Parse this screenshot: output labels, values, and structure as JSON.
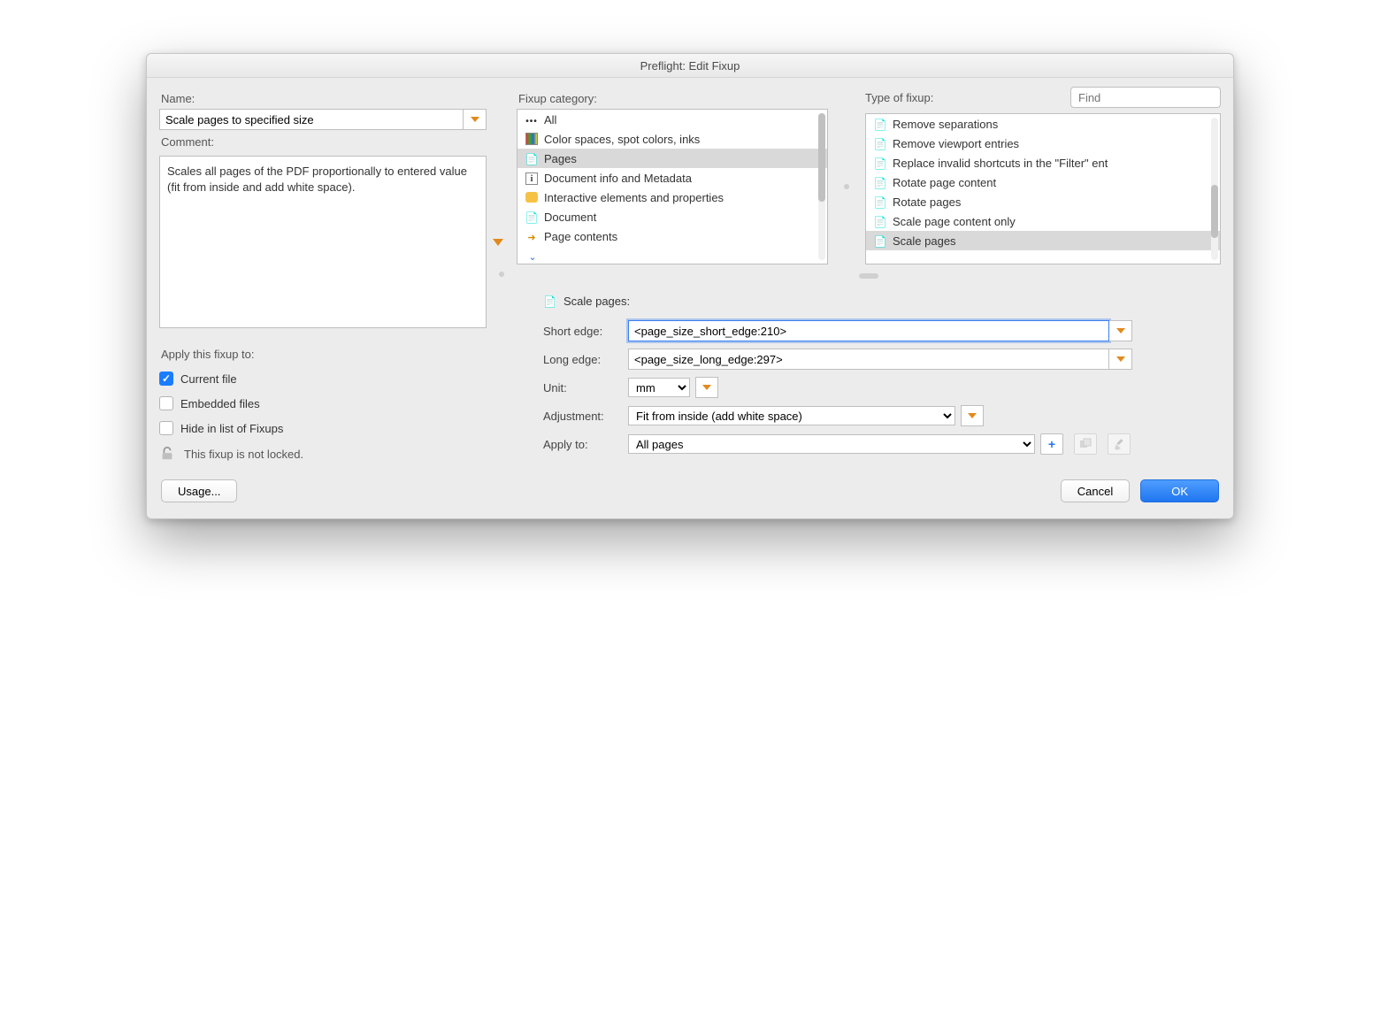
{
  "window": {
    "title": "Preflight: Edit Fixup"
  },
  "left": {
    "name_label": "Name:",
    "name_value": "Scale pages to specified size",
    "comment_label": "Comment:",
    "comment_text": "Scales all pages of the PDF proportionally to entered value (fit from inside and add white space).",
    "apply_label": "Apply this fixup to:",
    "chk_current": "Current file",
    "chk_embedded": "Embedded files",
    "chk_hide": "Hide in list of Fixups",
    "lock_text": "This fixup is not locked.",
    "usage_btn": "Usage..."
  },
  "categories": {
    "label": "Fixup category:",
    "items": [
      {
        "icon": "dots",
        "label": "All"
      },
      {
        "icon": "swatch",
        "label": "Color spaces, spot colors, inks"
      },
      {
        "icon": "pdf",
        "label": "Pages",
        "selected": true
      },
      {
        "icon": "info",
        "label": "Document info and Metadata"
      },
      {
        "icon": "bubble",
        "label": "Interactive elements and properties"
      },
      {
        "icon": "pdf",
        "label": "Document"
      },
      {
        "icon": "arrow",
        "label": "Page contents"
      }
    ]
  },
  "types": {
    "label": "Type of fixup:",
    "find_placeholder": "Find",
    "items": [
      {
        "label": "Remove separations"
      },
      {
        "label": "Remove viewport entries"
      },
      {
        "label": "Replace invalid shortcuts in the \"Filter\" ent"
      },
      {
        "label": "Rotate page content"
      },
      {
        "label": "Rotate pages"
      },
      {
        "label": "Scale page content only"
      },
      {
        "label": "Scale pages",
        "selected": true
      }
    ]
  },
  "settings": {
    "title": "Scale pages:",
    "short_edge_label": "Short edge:",
    "short_edge_value": "<page_size_short_edge:210>",
    "long_edge_label": "Long edge:",
    "long_edge_value": "<page_size_long_edge:297>",
    "unit_label": "Unit:",
    "unit_value": "mm",
    "adjustment_label": "Adjustment:",
    "adjustment_value": "Fit from inside (add white space)",
    "apply_to_label": "Apply to:",
    "apply_to_value": "All pages"
  },
  "footer": {
    "cancel": "Cancel",
    "ok": "OK"
  }
}
